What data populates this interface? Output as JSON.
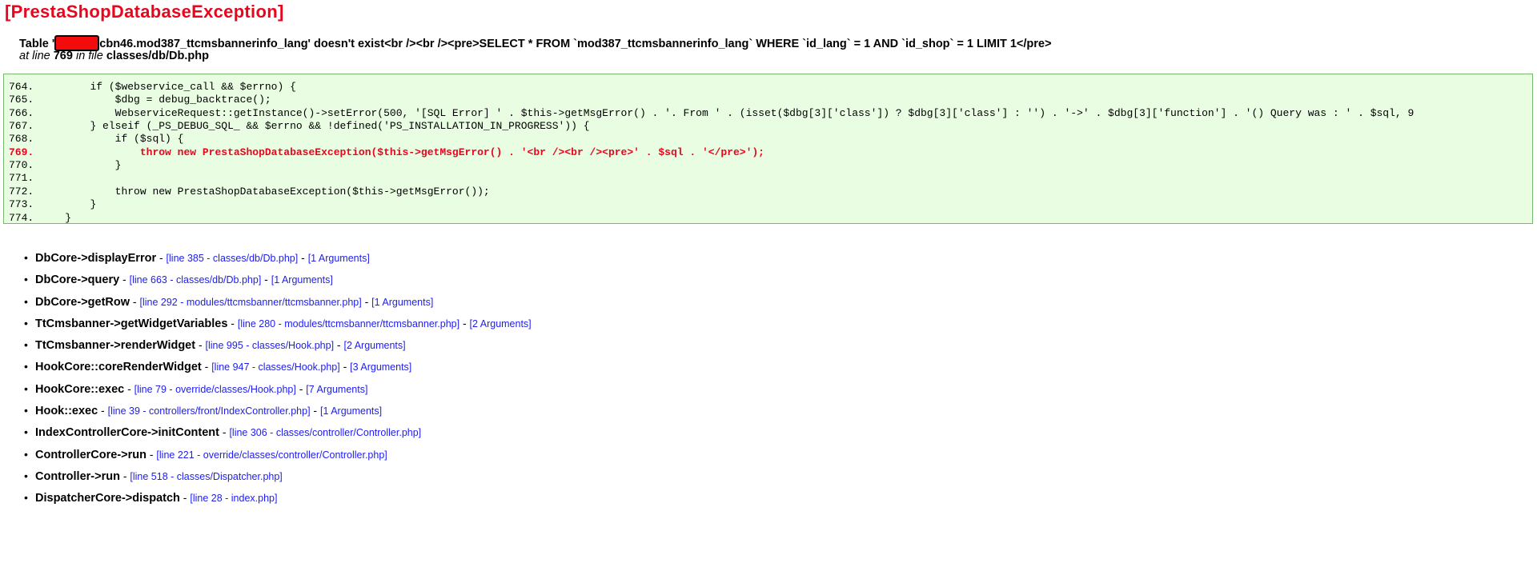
{
  "error": {
    "title": "[PrestaShopDatabaseException]",
    "message_prefix": "Table '",
    "message_suffix": "cbn46.mod387_ttcmsbannerinfo_lang' doesn't exist<br /><br /><pre>SELECT * FROM `mod387_ttcmsbannerinfo_lang` WHERE `id_lang` = 1 AND `id_shop` = 1 LIMIT 1</pre>",
    "at_line_label": "at line",
    "line_number": "769",
    "in_file_label": "in file",
    "file_path": "classes/db/Db.php"
  },
  "code": {
    "highlight_line": 769,
    "lines": [
      {
        "num": "764.",
        "text": "        if ($webservice_call && $errno) {"
      },
      {
        "num": "765.",
        "text": "            $dbg = debug_backtrace();"
      },
      {
        "num": "766.",
        "text": "            WebserviceRequest::getInstance()->setError(500, '[SQL Error] ' . $this->getMsgError() . '. From ' . (isset($dbg[3]['class']) ? $dbg[3]['class'] : '') . '->' . $dbg[3]['function'] . '() Query was : ' . $sql, 9"
      },
      {
        "num": "767.",
        "text": "        } elseif (_PS_DEBUG_SQL_ && $errno && !defined('PS_INSTALLATION_IN_PROGRESS')) {"
      },
      {
        "num": "768.",
        "text": "            if ($sql) {"
      },
      {
        "num": "769.",
        "text": "                throw new PrestaShopDatabaseException($this->getMsgError() . '<br /><br /><pre>' . $sql . '</pre>');"
      },
      {
        "num": "770.",
        "text": "            }"
      },
      {
        "num": "771.",
        "text": ""
      },
      {
        "num": "772.",
        "text": "            throw new PrestaShopDatabaseException($this->getMsgError());"
      },
      {
        "num": "773.",
        "text": "        }"
      },
      {
        "num": "774.",
        "text": "    }"
      }
    ]
  },
  "trace": [
    {
      "fn": "DbCore->displayError",
      "loc": "[line 385 - classes/db/Db.php]",
      "args": "[1 Arguments]"
    },
    {
      "fn": "DbCore->query",
      "loc": "[line 663 - classes/db/Db.php]",
      "args": "[1 Arguments]"
    },
    {
      "fn": "DbCore->getRow",
      "loc": "[line 292 - modules/ttcmsbanner/ttcmsbanner.php]",
      "args": "[1 Arguments]"
    },
    {
      "fn": "TtCmsbanner->getWidgetVariables",
      "loc": "[line 280 - modules/ttcmsbanner/ttcmsbanner.php]",
      "args": "[2 Arguments]"
    },
    {
      "fn": "TtCmsbanner->renderWidget",
      "loc": "[line 995 - classes/Hook.php]",
      "args": "[2 Arguments]"
    },
    {
      "fn": "HookCore::coreRenderWidget",
      "loc": "[line 947 - classes/Hook.php]",
      "args": "[3 Arguments]"
    },
    {
      "fn": "HookCore::exec",
      "loc": "[line 79 - override/classes/Hook.php]",
      "args": "[7 Arguments]"
    },
    {
      "fn": "Hook::exec",
      "loc": "[line 39 - controllers/front/IndexController.php]",
      "args": "[1 Arguments]"
    },
    {
      "fn": "IndexControllerCore->initContent",
      "loc": "[line 306 - classes/controller/Controller.php]",
      "args": ""
    },
    {
      "fn": "ControllerCore->run",
      "loc": "[line 221 - override/classes/controller/Controller.php]",
      "args": ""
    },
    {
      "fn": "Controller->run",
      "loc": "[line 518 - classes/Dispatcher.php]",
      "args": ""
    },
    {
      "fn": "DispatcherCore->dispatch",
      "loc": "[line 28 - index.php]",
      "args": ""
    }
  ],
  "ui": {
    "separator": " - ",
    "bullet": "•"
  }
}
